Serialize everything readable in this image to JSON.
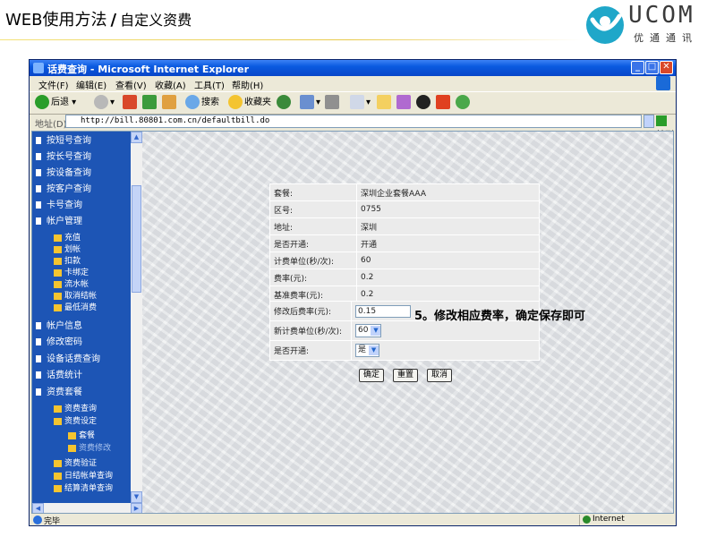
{
  "slide": {
    "title_main": "WEB使用方法",
    "separator": "/",
    "title_sub": "自定义资费",
    "logo_text": "UCOM",
    "logo_sub": "优通通讯"
  },
  "browser": {
    "window_title": "话费查询 - Microsoft Internet Explorer",
    "menu": [
      "文件(F)",
      "编辑(E)",
      "查看(V)",
      "收藏(A)",
      "工具(T)",
      "帮助(H)"
    ],
    "toolbar": {
      "back_label": "后退",
      "search_label": "搜索",
      "favorites_label": "收藏夹"
    },
    "address_label": "地址(D)",
    "address_url": "http://bill.80801.com.cn/defaultbill.do",
    "go_label": "转到",
    "status_text": "完毕",
    "zone_text": "Internet"
  },
  "sidebar": {
    "items_top": [
      "按短号查询",
      "按长号查询",
      "按设备查询",
      "按客户查询",
      "卡号查询",
      "帐户管理"
    ],
    "account_sub": [
      "充值",
      "划帐",
      "扣款",
      "卡绑定",
      "流水帐",
      "取消结帐",
      "最低消费"
    ],
    "items_mid": [
      "帐户信息",
      "修改密码",
      "设备话费查询",
      "话费统计",
      "资费套餐"
    ],
    "tariff_sub": [
      "资费查询",
      "资费设定"
    ],
    "tariff_subsub": [
      "套餐",
      "资费修改"
    ],
    "items_bottom": [
      "资费验证",
      "日结帐单查询",
      "结算清单查询"
    ]
  },
  "info": {
    "rows": [
      {
        "label": "套餐:",
        "value": "深圳企业套餐AAA"
      },
      {
        "label": "区号:",
        "value": "0755"
      },
      {
        "label": "地址:",
        "value": "深圳"
      },
      {
        "label": "是否开通:",
        "value": "开通"
      },
      {
        "label": "计费单位(秒/次):",
        "value": "60"
      },
      {
        "label": "费率(元):",
        "value": "0.2"
      },
      {
        "label": "基准费率(元):",
        "value": "0.2"
      }
    ]
  },
  "form": {
    "rate_label": "修改后费率(元):",
    "rate_value": "0.15",
    "unit_label": "新计费单位(秒/次):",
    "unit_value": "60",
    "enable_label": "是否开通:",
    "enable_value": "是",
    "confirm_label": "确定",
    "reset_label": "重置",
    "cancel_label": "取消"
  },
  "annotation": "5。修改相应费率，确定保存即可",
  "colors": {
    "titlebar": "#0a5ae0",
    "sidebar": "#1d55b5",
    "page_bg": "#e4e6e8"
  }
}
